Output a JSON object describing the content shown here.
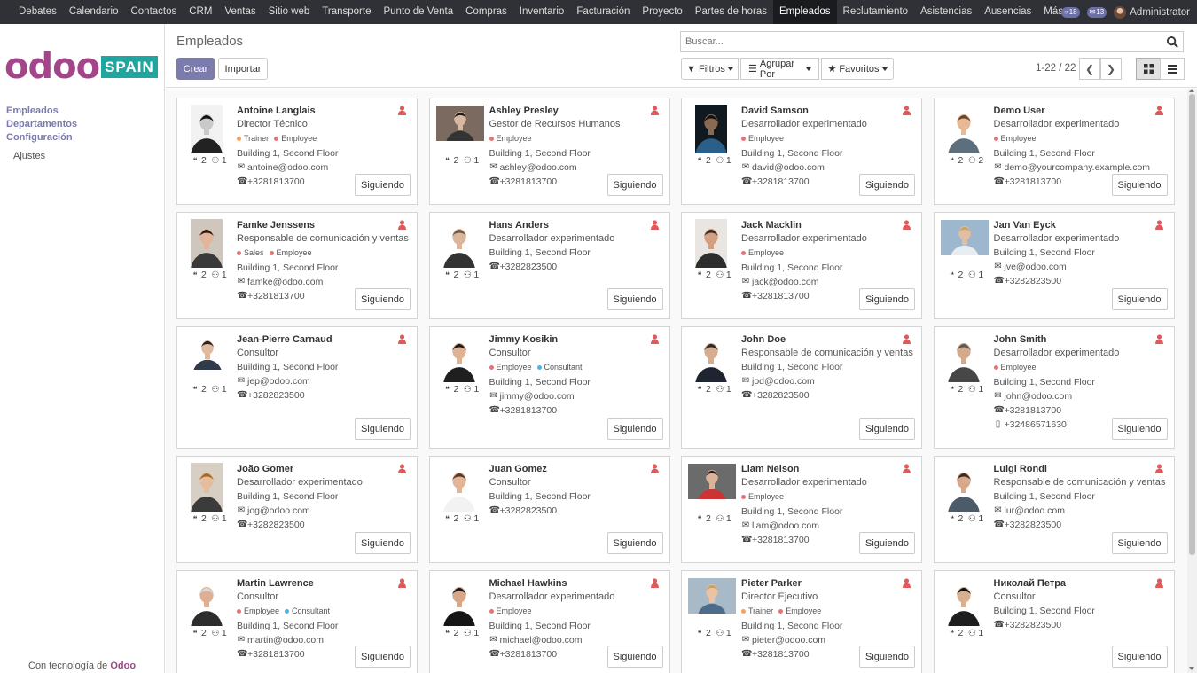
{
  "topbar": {
    "menu": [
      "Debates",
      "Calendario",
      "Contactos",
      "CRM",
      "Ventas",
      "Sitio web",
      "Transporte",
      "Punto de Venta",
      "Compras",
      "Inventario",
      "Facturación",
      "Proyecto",
      "Partes de horas",
      "Empleados",
      "Reclutamiento",
      "Asistencias",
      "Ausencias",
      "Más"
    ],
    "active": "Empleados",
    "badge_messages": "18",
    "badge_chat": "13",
    "user": "Administrator"
  },
  "sidebar": {
    "logo_text": "odoo",
    "logo_tag": "SPAIN",
    "items": [
      "Empleados",
      "Departamentos",
      "Configuración"
    ],
    "sub_items": [
      "Ajustes"
    ],
    "powered_prefix": "Con tecnología de",
    "powered_brand": "Odoo"
  },
  "control_panel": {
    "title": "Empleados",
    "create": "Crear",
    "import": "Importar",
    "search_placeholder": "Buscar...",
    "filters": "Filtros",
    "group_by": "Agrupar Por",
    "favorites": "Favoritos",
    "pager": "1-22 / 22"
  },
  "colors": {
    "accent": "#7c7bad",
    "brand": "#a24689",
    "tag_trainer": "#f4a261",
    "tag_employee": "#e57373",
    "tag_sales": "#e57373",
    "tag_consultant": "#4fb3e0",
    "presence": "#e05a5a"
  },
  "button_follow": "Siguiendo",
  "employees": [
    {
      "name": "Antoine Langlais",
      "job": "Director Técnico",
      "tags": [
        "Trainer",
        "Employee"
      ],
      "address": "Building 1, Second Floor",
      "email": "antoine@odoo.com",
      "phone": "+3281813700",
      "followers": "2",
      "members": "1"
    },
    {
      "name": "Ashley Presley",
      "job": "Gestor de Recursos Humanos",
      "tags": [
        "Employee"
      ],
      "address": "Building 1, Second Floor",
      "email": "ashley@odoo.com",
      "phone": "+3281813700",
      "followers": "2",
      "members": "1"
    },
    {
      "name": "David Samson",
      "job": "Desarrollador experimentado",
      "tags": [
        "Employee"
      ],
      "address": "Building 1, Second Floor",
      "email": "david@odoo.com",
      "phone": "+3281813700",
      "followers": "2",
      "members": "1"
    },
    {
      "name": "Demo User",
      "job": "Desarrollador experimentado",
      "tags": [
        "Employee"
      ],
      "address": "Building 1, Second Floor",
      "email": "demo@yourcompany.example.com",
      "phone": "+3281813700",
      "followers": "2",
      "members": "2"
    },
    {
      "name": "Famke Jenssens",
      "job": "Responsable de comunicación y ventas",
      "tags": [
        "Sales",
        "Employee"
      ],
      "address": "Building 1, Second Floor",
      "email": "famke@odoo.com",
      "phone": "+3281813700",
      "followers": "2",
      "members": "1"
    },
    {
      "name": "Hans Anders",
      "job": "Desarrollador experimentado",
      "tags": [],
      "address": "Building 1, Second Floor",
      "email": "",
      "phone": "+3282823500",
      "followers": "2",
      "members": "1"
    },
    {
      "name": "Jack Macklin",
      "job": "Desarrollador experimentado",
      "tags": [
        "Employee"
      ],
      "address": "Building 1, Second Floor",
      "email": "jack@odoo.com",
      "phone": "+3281813700",
      "followers": "2",
      "members": "1"
    },
    {
      "name": "Jan Van Eyck",
      "job": "Desarrollador experimentado",
      "tags": [],
      "address": "Building 1, Second Floor",
      "email": "jve@odoo.com",
      "phone": "+3282823500",
      "followers": "2",
      "members": "1"
    },
    {
      "name": "Jean-Pierre Carnaud",
      "job": "Consultor",
      "tags": [],
      "address": "Building 1, Second Floor",
      "email": "jep@odoo.com",
      "phone": "+3282823500",
      "followers": "2",
      "members": "1"
    },
    {
      "name": "Jimmy Kosikin",
      "job": "Consultor",
      "tags": [
        "Employee",
        "Consultant"
      ],
      "address": "Building 1, Second Floor",
      "email": "jimmy@odoo.com",
      "phone": "+3281813700",
      "followers": "2",
      "members": "1"
    },
    {
      "name": "John Doe",
      "job": "Responsable de comunicación y ventas",
      "tags": [],
      "address": "Building 1, Second Floor",
      "email": "jod@odoo.com",
      "phone": "+3282823500",
      "followers": "2",
      "members": "1"
    },
    {
      "name": "John Smith",
      "job": "Desarrollador experimentado",
      "tags": [
        "Employee"
      ],
      "address": "Building 1, Second Floor",
      "email": "john@odoo.com",
      "phone": "+3281813700",
      "mobile": "+32486571630",
      "followers": "2",
      "members": "1"
    },
    {
      "name": "João Gomer",
      "job": "Desarrollador experimentado",
      "tags": [],
      "address": "Building 1, Second Floor",
      "email": "jog@odoo.com",
      "phone": "+3282823500",
      "followers": "2",
      "members": "1"
    },
    {
      "name": "Juan Gomez",
      "job": "Consultor",
      "tags": [],
      "address": "Building 1, Second Floor",
      "email": "",
      "phone": "+3282823500",
      "followers": "2",
      "members": "1"
    },
    {
      "name": "Liam Nelson",
      "job": "Desarrollador experimentado",
      "tags": [
        "Employee"
      ],
      "address": "Building 1, Second Floor",
      "email": "liam@odoo.com",
      "phone": "+3281813700",
      "followers": "2",
      "members": "1"
    },
    {
      "name": "Luigi Rondi",
      "job": "Responsable de comunicación y ventas",
      "tags": [],
      "address": "Building 1, Second Floor",
      "email": "lur@odoo.com",
      "phone": "+3282823500",
      "followers": "2",
      "members": "1"
    },
    {
      "name": "Martin Lawrence",
      "job": "Consultor",
      "tags": [
        "Employee",
        "Consultant"
      ],
      "address": "Building 1, Second Floor",
      "email": "martin@odoo.com",
      "phone": "+3281813700",
      "followers": "2",
      "members": "1"
    },
    {
      "name": "Michael Hawkins",
      "job": "Desarrollador experimentado",
      "tags": [
        "Employee"
      ],
      "address": "Building 1, Second Floor",
      "email": "michael@odoo.com",
      "phone": "+3281813700",
      "followers": "2",
      "members": "1"
    },
    {
      "name": "Pieter Parker",
      "job": "Director Ejecutivo",
      "tags": [
        "Trainer",
        "Employee"
      ],
      "address": "Building 1, Second Floor",
      "email": "pieter@odoo.com",
      "phone": "+3281813700",
      "followers": "2",
      "members": "1"
    },
    {
      "name": "Николай Петра",
      "job": "Consultor",
      "tags": [],
      "address": "Building 1, Second Floor",
      "email": "",
      "phone": "+3282823500",
      "followers": "2",
      "members": "1"
    }
  ]
}
